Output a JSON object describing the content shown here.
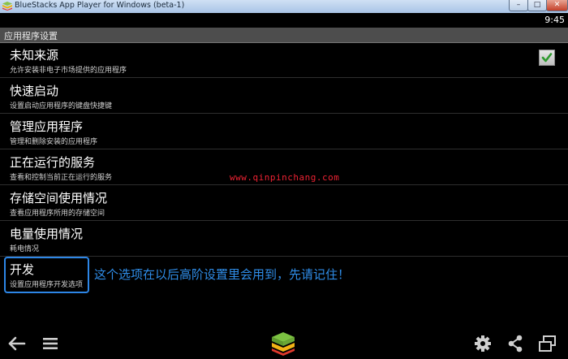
{
  "window": {
    "title": "BlueStacks App Player for Windows (beta-1)",
    "min_label": "–",
    "max_label": "□",
    "close_label": "✕"
  },
  "status_bar": {
    "time": "9:45"
  },
  "header": {
    "title": "应用程序设置"
  },
  "settings": [
    {
      "title": "未知来源",
      "summary": "允许安装非电子市场提供的应用程序",
      "checked": true
    },
    {
      "title": "快速启动",
      "summary": "设置启动应用程序的键盘快捷键"
    },
    {
      "title": "管理应用程序",
      "summary": "管理和删除安装的应用程序"
    },
    {
      "title": "正在运行的服务",
      "summary": "查看和控制当前正在运行的服务"
    },
    {
      "title": "存储空间使用情况",
      "summary": "查看应用程序所用的存储空间"
    },
    {
      "title": "电量使用情况",
      "summary": "耗电情况"
    },
    {
      "title": "开发",
      "summary": "设置应用程序开发选项"
    }
  ],
  "annotation": "这个选项在以后高阶设置里会用到，先请记住！",
  "watermark": "www.qinpinchang.com",
  "nav_icons": [
    "back-arrow-icon",
    "menu-icon",
    "bluestacks-home-icon",
    "gear-icon",
    "share-icon",
    "window-mode-icon"
  ],
  "colors": {
    "accent_blue": "#2f8de8",
    "watermark_red": "#e22233",
    "check_green": "#2e9a2e",
    "header_bg": "#4d4d4d"
  }
}
